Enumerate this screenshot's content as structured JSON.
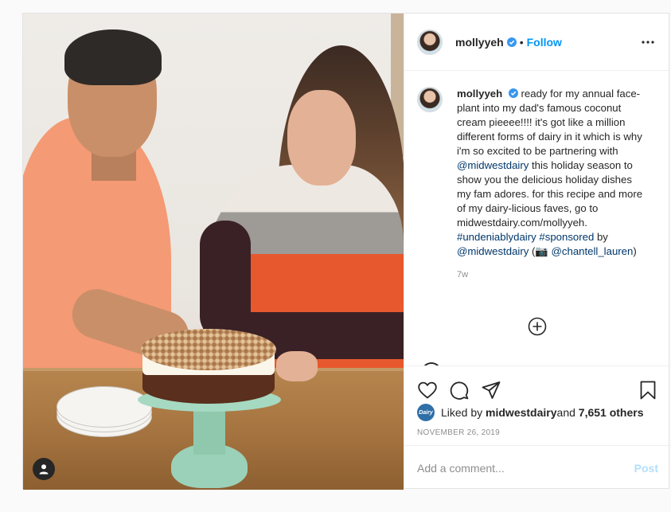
{
  "post": {
    "photo": {
      "alt_icon": "user-tag-icon",
      "palette": {
        "shirt": "#f49a74",
        "sweater_orange": "#e8582e",
        "cake_stand": "#a6d9c1",
        "table": "#a4733f"
      }
    },
    "header": {
      "username": "mollyyeh",
      "separator": "•",
      "follow_label": "Follow",
      "more_icon": "more-horizontal-icon"
    },
    "caption": {
      "username": "mollyyeh",
      "text_1": "ready for my annual face-plant into my dad's famous coconut cream pieeee!!!! it's got like a million different forms of dairy in it which is why i'm so excited to be partnering with ",
      "mention_1": "@midwestdairy",
      "text_2": " this holiday season to show you the delicious holiday dishes my fam adores. for this recipe and more of my dairy-licious faves, go to midwestdairy.com/mollyyeh. ",
      "hashtag_1": "#undeniablydairy",
      "text_3": " ",
      "hashtag_2": "#sponsored",
      "text_4": " by ",
      "mention_2": "@midwestdairy",
      "text_5": " (",
      "camera_emoji": "📷",
      "text_6": " ",
      "mention_3": "@chantell_lauren",
      "text_7": ")",
      "time": "7w"
    },
    "actions": {
      "like_icon": "heart-icon",
      "comment_icon": "comment-icon",
      "share_icon": "share-icon",
      "save_icon": "bookmark-icon"
    },
    "likes": {
      "prefix": "Liked by ",
      "user": "midwestdairy",
      "and": " and ",
      "others": "7,651 others",
      "avatar_text": "Dairy"
    },
    "date": "NOVEMBER 26, 2019",
    "add_comment": {
      "placeholder": "Add a comment...",
      "post_label": "Post"
    },
    "colors": {
      "follow": "#0095f6",
      "link": "#00376b",
      "post_disabled": "#b2dffc",
      "muted": "#8e8e8e"
    }
  }
}
